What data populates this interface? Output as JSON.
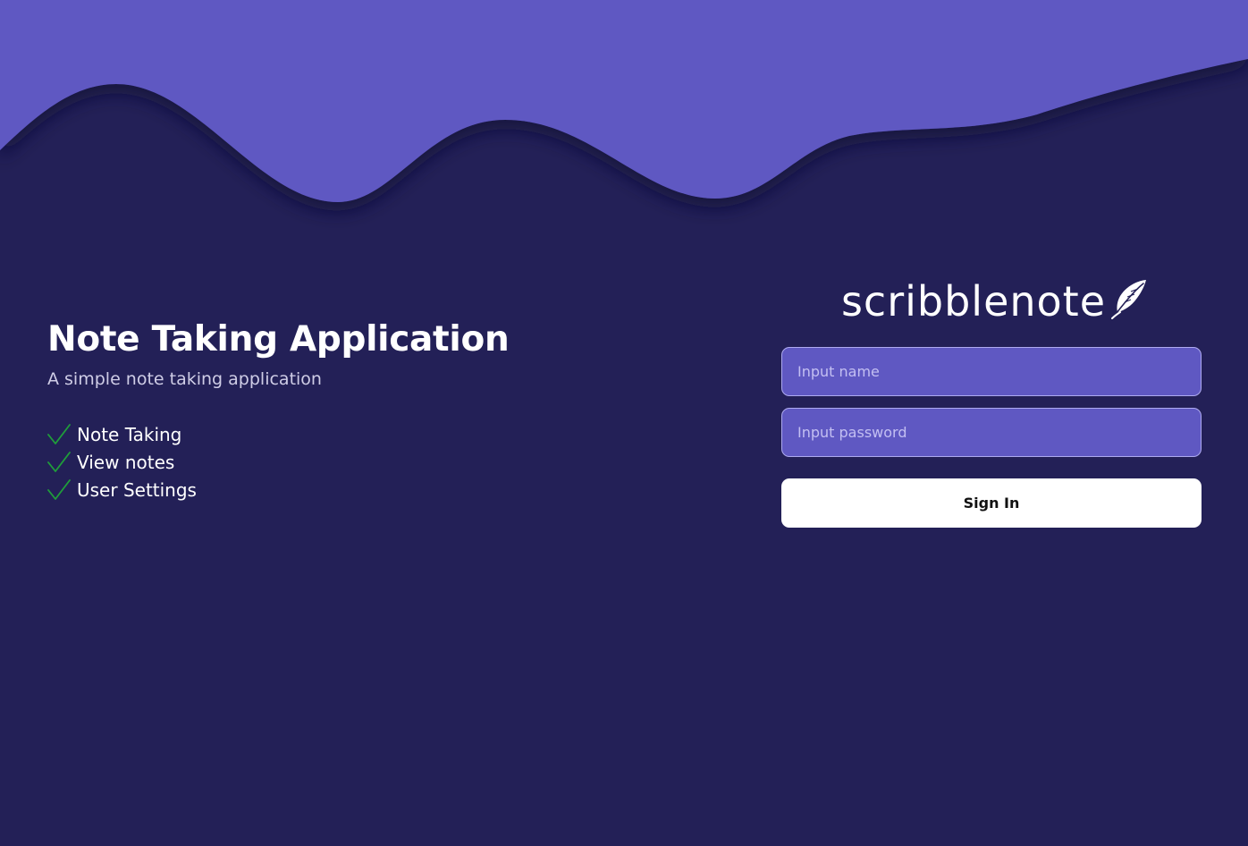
{
  "colors": {
    "background": "#232057",
    "accent": "#5f58c2",
    "check": "#1f9e3a"
  },
  "hero": {
    "title": "Note Taking Application",
    "subtitle": "A simple note taking application",
    "features": [
      {
        "label": "Note Taking",
        "icon": "check-icon"
      },
      {
        "label": "View notes",
        "icon": "check-icon"
      },
      {
        "label": "User Settings",
        "icon": "check-icon"
      }
    ]
  },
  "login": {
    "logo_text": "scribblenote",
    "logo_icon": "feather-icon",
    "name_placeholder": "Input name",
    "password_placeholder": "Input password",
    "signin_label": "Sign In"
  }
}
